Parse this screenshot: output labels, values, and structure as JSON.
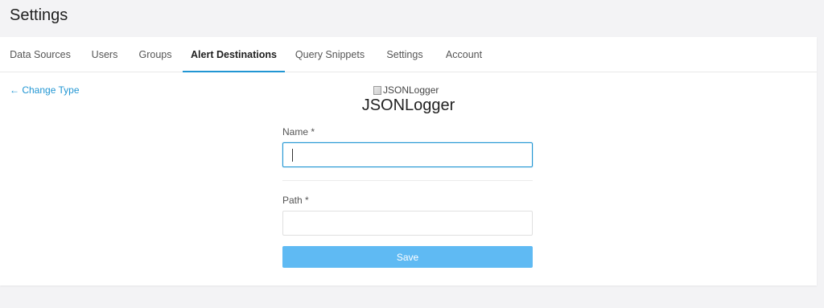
{
  "header": {
    "title": "Settings"
  },
  "tabs": [
    {
      "label": "Data Sources",
      "active": false
    },
    {
      "label": "Users",
      "active": false
    },
    {
      "label": "Groups",
      "active": false
    },
    {
      "label": "Alert Destinations",
      "active": true
    },
    {
      "label": "Query Snippets",
      "active": false
    },
    {
      "label": "Settings",
      "active": false
    },
    {
      "label": "Account",
      "active": false
    }
  ],
  "back_link": {
    "label": "← Change Type"
  },
  "destination": {
    "logo_alt": "JSONLogger",
    "title": "JSONLogger"
  },
  "form": {
    "name_label": "Name *",
    "name_value": "",
    "path_label": "Path *",
    "path_value": "",
    "save_label": "Save"
  },
  "colors": {
    "accent": "#2196d3",
    "save_button": "#5fbaf3",
    "background": "#f3f3f5"
  }
}
